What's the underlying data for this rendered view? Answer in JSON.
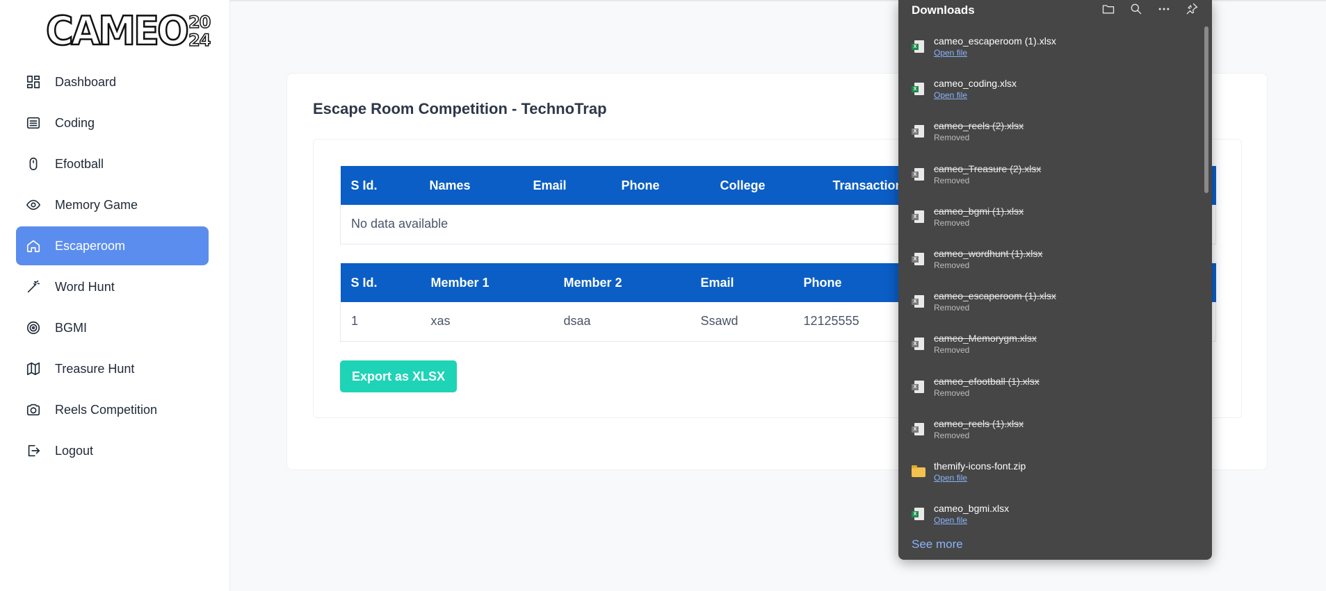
{
  "logo": {
    "main": "CAMEO",
    "year_top": "20",
    "year_bottom": "24"
  },
  "sidebar": {
    "items": [
      {
        "label": "Dashboard",
        "icon": "dashboard-icon"
      },
      {
        "label": "Coding",
        "icon": "list-icon"
      },
      {
        "label": "Efootball",
        "icon": "mouse-icon"
      },
      {
        "label": "Memory Game",
        "icon": "eye-icon"
      },
      {
        "label": "Escaperoom",
        "icon": "home-icon",
        "active": true
      },
      {
        "label": "Word Hunt",
        "icon": "magic-wand-icon"
      },
      {
        "label": "BGMI",
        "icon": "target-icon"
      },
      {
        "label": "Treasure Hunt",
        "icon": "map-icon"
      },
      {
        "label": "Reels Competition",
        "icon": "camera-icon"
      },
      {
        "label": "Logout",
        "icon": "logout-icon"
      }
    ]
  },
  "main": {
    "title": "Escape Room Competition - TechnoTrap",
    "table1": {
      "headers": [
        "S Id.",
        "Names",
        "Email",
        "Phone",
        "College",
        "Transaction"
      ],
      "empty_text": "No data available"
    },
    "table2": {
      "headers": [
        "S Id.",
        "Member 1",
        "Member 2",
        "Email",
        "Phone"
      ],
      "rows": [
        [
          "1",
          "xas",
          "dsaa",
          "Ssawd",
          "12125555"
        ]
      ]
    },
    "export_label": "Export as XLSX"
  },
  "downloads": {
    "title": "Downloads",
    "see_more": "See more",
    "items": [
      {
        "name": "cameo_escaperoom (1).xlsx",
        "status": "Open file",
        "removed": false,
        "type": "xlsx"
      },
      {
        "name": "cameo_coding.xlsx",
        "status": "Open file",
        "removed": false,
        "type": "xlsx"
      },
      {
        "name": "cameo_reels (2).xlsx",
        "status": "Removed",
        "removed": true,
        "type": "xlsx"
      },
      {
        "name": "cameo_Treasure (2).xlsx",
        "status": "Removed",
        "removed": true,
        "type": "xlsx"
      },
      {
        "name": "cameo_bgmi (1).xlsx",
        "status": "Removed",
        "removed": true,
        "type": "xlsx"
      },
      {
        "name": "cameo_wordhunt (1).xlsx",
        "status": "Removed",
        "removed": true,
        "type": "xlsx"
      },
      {
        "name": "cameo_escaperoom (1).xlsx",
        "status": "Removed",
        "removed": true,
        "type": "xlsx"
      },
      {
        "name": "cameo_Memorygm.xlsx",
        "status": "Removed",
        "removed": true,
        "type": "xlsx"
      },
      {
        "name": "cameo_efootball (1).xlsx",
        "status": "Removed",
        "removed": true,
        "type": "xlsx"
      },
      {
        "name": "cameo_reels (1).xlsx",
        "status": "Removed",
        "removed": true,
        "type": "xlsx"
      },
      {
        "name": "themify-icons-font.zip",
        "status": "Open file",
        "removed": false,
        "type": "zip"
      },
      {
        "name": "cameo_bgmi.xlsx",
        "status": "Open file",
        "removed": false,
        "type": "xlsx"
      }
    ]
  },
  "colors": {
    "accent": "#5b8def",
    "table_header": "#0b5ec5",
    "export": "#1fd3b6",
    "panel": "#464646",
    "link": "#8ab4f8"
  }
}
